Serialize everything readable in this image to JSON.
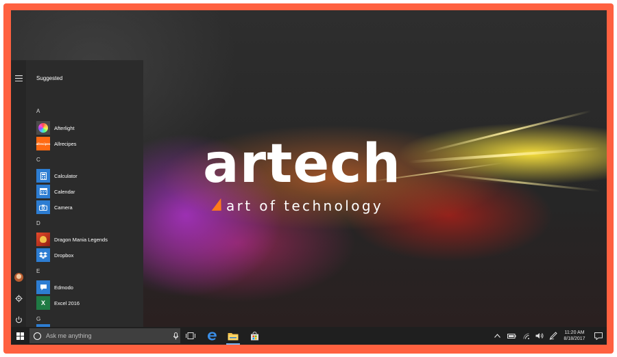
{
  "wallpaper": {
    "logo_main": "artech",
    "logo_tagline": "art of technology",
    "accent_color": "#ff7a1a"
  },
  "frame_color": "#ff6140",
  "start_menu": {
    "menu_icon": "hamburger-icon",
    "suggested_label": "Suggested",
    "groups": [
      {
        "letter": "A",
        "apps": [
          {
            "label": "Afterlight",
            "icon": "afterlight-icon",
            "color": "#5a5a5a"
          },
          {
            "label": "Allrecipes",
            "icon": "allrecipes-icon",
            "color": "#ff6a13"
          }
        ]
      },
      {
        "letter": "C",
        "apps": [
          {
            "label": "Calculator",
            "icon": "calculator-icon",
            "color": "#2d7dd2"
          },
          {
            "label": "Calendar",
            "icon": "calendar-icon",
            "color": "#2d7dd2"
          },
          {
            "label": "Camera",
            "icon": "camera-icon",
            "color": "#2d7dd2"
          }
        ]
      },
      {
        "letter": "D",
        "apps": [
          {
            "label": "Dragon Mania Legends",
            "icon": "dragon-icon",
            "color": "#c83a2a"
          },
          {
            "label": "Dropbox",
            "icon": "dropbox-icon",
            "color": "#2d7dd2"
          }
        ]
      },
      {
        "letter": "E",
        "apps": [
          {
            "label": "Edmodo",
            "icon": "edmodo-icon",
            "color": "#2d7dd2"
          },
          {
            "label": "Excel 2016",
            "icon": "excel-icon",
            "color": "#1f7a44"
          }
        ]
      },
      {
        "letter": "G",
        "apps": []
      }
    ],
    "allrecipes_tile_text": "allrecipes",
    "excel_tile_text": "X"
  },
  "taskbar": {
    "search_placeholder": "Ask me anything",
    "pinned": [
      "task-view-icon",
      "edge-icon",
      "file-explorer-icon",
      "store-icon"
    ],
    "tray": [
      "chevron-up-icon",
      "battery-icon",
      "wifi-icon",
      "volume-icon",
      "pen-icon"
    ],
    "time": "11:20 AM",
    "date": "8/18/2017",
    "windows_blue": "#0078d7"
  }
}
